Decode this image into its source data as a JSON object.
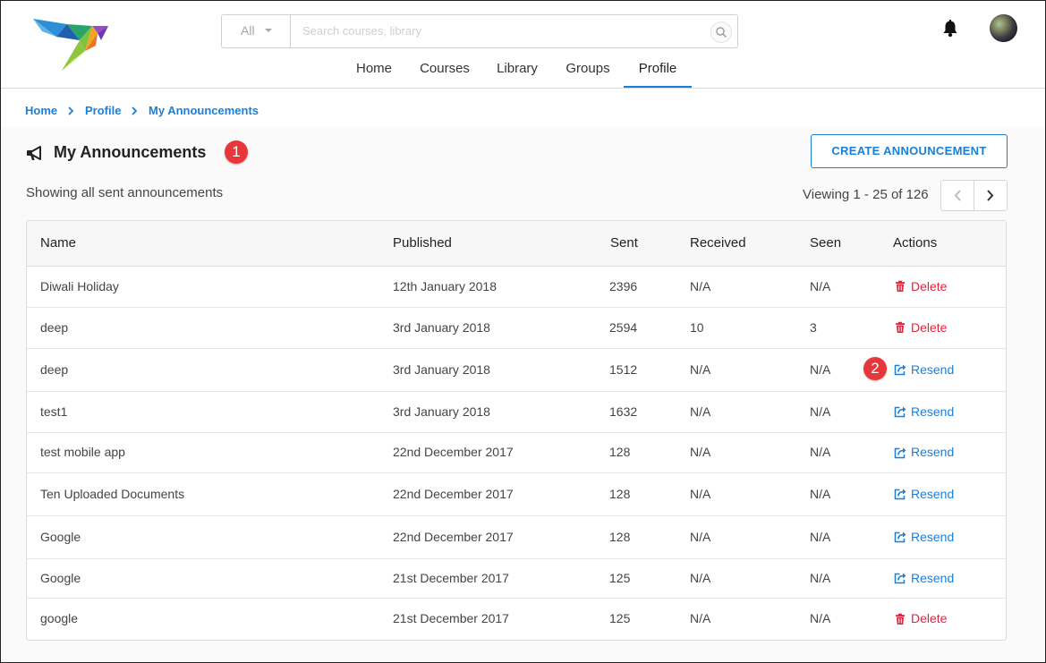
{
  "header": {
    "search": {
      "category": "All",
      "placeholder": "Search courses, library"
    },
    "nav": [
      "Home",
      "Courses",
      "Library",
      "Groups",
      "Profile"
    ],
    "active_nav": "Profile"
  },
  "breadcrumb": [
    "Home",
    "Profile",
    "My Announcements"
  ],
  "page": {
    "title": "My Announcements",
    "create_label": "CREATE ANNOUNCEMENT",
    "subtitle": "Showing all sent announcements",
    "viewing": "Viewing 1 - 25 of 126"
  },
  "markers": [
    "1",
    "2"
  ],
  "table": {
    "headers": [
      "Name",
      "Published",
      "Sent",
      "Received",
      "Seen",
      "Actions"
    ],
    "rows": [
      {
        "name": "Diwali Holiday",
        "published": "12th January 2018",
        "sent": "2396",
        "received": "N/A",
        "seen": "N/A",
        "action": "Delete"
      },
      {
        "name": "deep",
        "published": "3rd January 2018",
        "sent": "2594",
        "received": "10",
        "seen": "3",
        "action": "Delete"
      },
      {
        "name": "deep",
        "published": "3rd January 2018",
        "sent": "1512",
        "received": "N/A",
        "seen": "N/A",
        "action": "Resend"
      },
      {
        "name": "test1",
        "published": "3rd January 2018",
        "sent": "1632",
        "received": "N/A",
        "seen": "N/A",
        "action": "Resend"
      },
      {
        "name": "test mobile app",
        "published": "22nd December 2017",
        "sent": "128",
        "received": "N/A",
        "seen": "N/A",
        "action": "Resend"
      },
      {
        "name": "Ten Uploaded Documents",
        "published": "22nd December 2017",
        "sent": "128",
        "received": "N/A",
        "seen": "N/A",
        "action": "Resend"
      },
      {
        "name": "Google",
        "published": "22nd December 2017",
        "sent": "128",
        "received": "N/A",
        "seen": "N/A",
        "action": "Resend"
      },
      {
        "name": "Google",
        "published": "21st December 2017",
        "sent": "125",
        "received": "N/A",
        "seen": "N/A",
        "action": "Resend"
      },
      {
        "name": "google",
        "published": "21st December 2017",
        "sent": "125",
        "received": "N/A",
        "seen": "N/A",
        "action": "Delete"
      }
    ]
  },
  "colors": {
    "accent": "#1a7fd8",
    "delete": "#e0253e",
    "marker": "#e8373a"
  }
}
